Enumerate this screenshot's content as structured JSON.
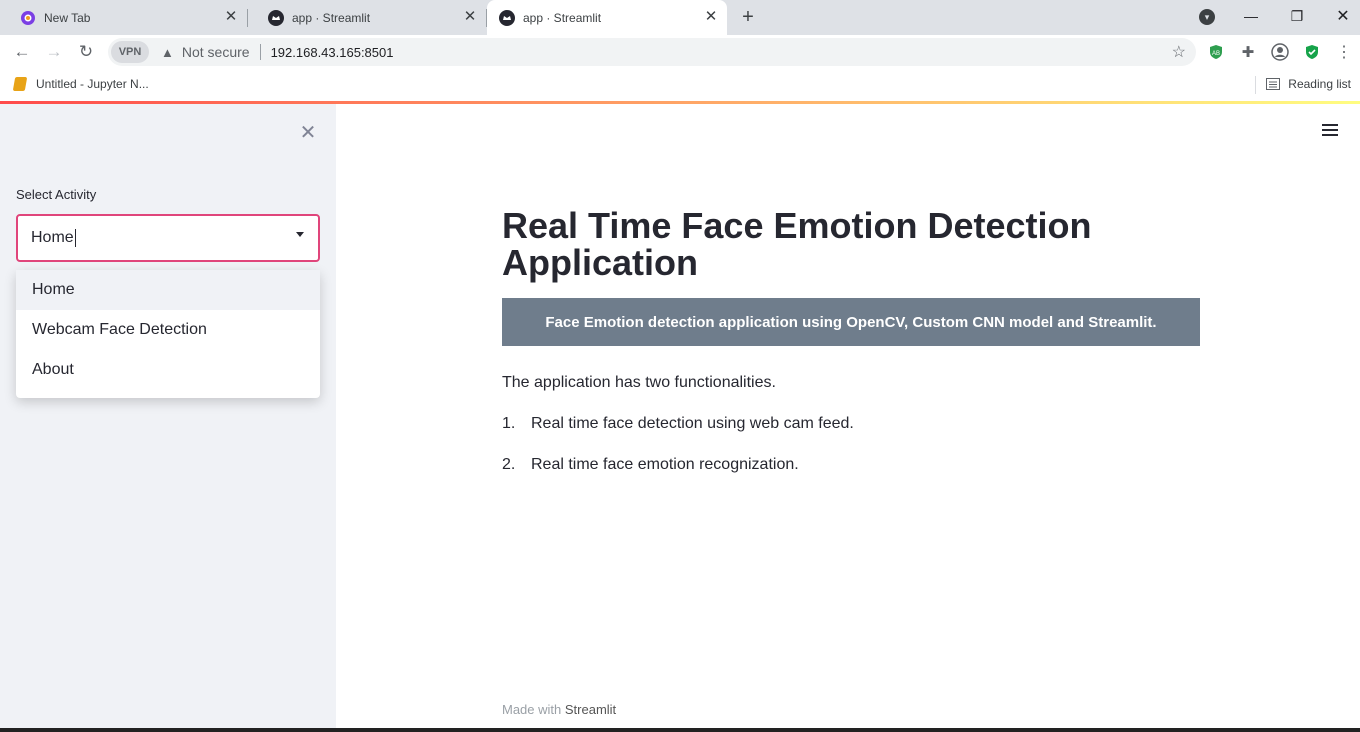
{
  "browser": {
    "tabs": [
      {
        "title": "New Tab",
        "active": false
      },
      {
        "title": "app · Streamlit",
        "active": false
      },
      {
        "title": "app · Streamlit",
        "active": true
      }
    ],
    "new_tab_icon": "plus-icon",
    "window_controls": [
      "minimize",
      "restore",
      "close"
    ],
    "vpn_label": "VPN",
    "security_text": "Not secure",
    "url": "192.168.43.165:8501",
    "extensions": [
      "adblock",
      "puzzle",
      "profile",
      "shield"
    ]
  },
  "bookmarks": {
    "item_label": "Untitled - Jupyter N...",
    "reading_list_label": "Reading list"
  },
  "sidebar": {
    "select_label": "Select Activity",
    "select_value": "Home",
    "options": [
      "Home",
      "Webcam Face Detection",
      "About"
    ],
    "selected_index": 0
  },
  "main": {
    "title": "Real Time Face Emotion Detection Application",
    "banner": "Face Emotion detection application using OpenCV, Custom CNN model and Streamlit.",
    "intro": "The application has two functionalities.",
    "features": [
      {
        "num": "1.",
        "text": "Real time face detection using web cam feed."
      },
      {
        "num": "2.",
        "text": "Real time face emotion recognization."
      }
    ],
    "footer_prefix": "Made with",
    "footer_brand": "Streamlit"
  },
  "colors": {
    "select_border": "#e0457b",
    "banner_bg": "#6f7d8c",
    "sidebar_bg": "#f0f2f6"
  }
}
